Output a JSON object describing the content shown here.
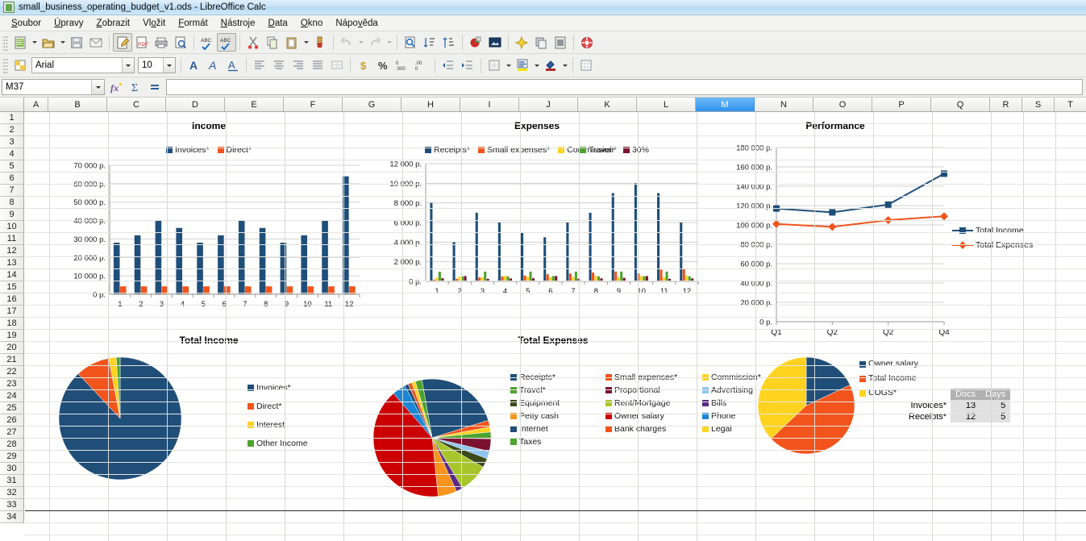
{
  "window": {
    "title": "small_business_operating_budget_v1.ods - LibreOffice Calc",
    "app_icon": "calc-document-icon"
  },
  "menubar": {
    "items": [
      {
        "label": "Soubor"
      },
      {
        "label": "Úpravy"
      },
      {
        "label": "Zobrazit"
      },
      {
        "label": "Vložit"
      },
      {
        "label": "Formát"
      },
      {
        "label": "Nástroje"
      },
      {
        "label": "Data"
      },
      {
        "label": "Okno"
      },
      {
        "label": "Nápověda"
      }
    ]
  },
  "formula_bar": {
    "name_box_value": "M37",
    "input_line_value": "",
    "function_wizard": "fx",
    "sum": "Σ",
    "formula": "="
  },
  "font_controls": {
    "font_name": "Arial",
    "font_size": "10"
  },
  "grid": {
    "columns": [
      "A",
      "B",
      "C",
      "D",
      "E",
      "F",
      "G",
      "H",
      "I",
      "J",
      "K",
      "L",
      "M",
      "N",
      "O",
      "P",
      "Q",
      "R",
      "S",
      "T"
    ],
    "selected_column": "M",
    "rows": [
      1,
      2,
      3,
      4,
      5,
      6,
      7,
      8,
      9,
      10,
      11,
      12,
      13,
      14,
      15,
      16,
      17,
      18,
      19,
      20,
      21,
      22,
      23,
      24,
      25,
      26,
      27,
      28,
      29,
      30,
      31,
      32,
      33,
      34
    ]
  },
  "colors": {
    "series_blue": "#1f4e79",
    "series_orange": "#f2541b",
    "series_yellow": "#ffd320",
    "series_green": "#4ca32e",
    "series_darkred": "#7b1230",
    "series_lightblue": "#8ec6f0",
    "series_darkgreen": "#3b4a1b",
    "series_olive": "#a8c62c",
    "series_purple": "#5b2a86",
    "series_lightorange": "#f7941e",
    "series_red": "#cc0000",
    "series_phone_blue": "#1887d6",
    "series_internet": "#1f4e79",
    "series_bank": "#f2541b",
    "series_legal": "#ffd320",
    "series_taxes": "#4ca32e",
    "selection_blue": "#2f92ef"
  },
  "chart_data": [
    {
      "type": "bar",
      "id": "income-bar-chart",
      "title": "Income",
      "xlabel": "",
      "ylabel": "",
      "ylim": [
        0,
        70000
      ],
      "ytick_labels": [
        "70 000 p.",
        "60 000 p.",
        "50 000 p.",
        "40 000 p.",
        "30 000 p.",
        "20 000 p.",
        "10 000 p.",
        "0 p."
      ],
      "ytick_values": [
        70000,
        60000,
        50000,
        40000,
        30000,
        20000,
        10000,
        0
      ],
      "categories": [
        "1",
        "2",
        "3",
        "4",
        "5",
        "6",
        "7",
        "8",
        "9",
        "10",
        "11",
        "12"
      ],
      "legend_position": "top",
      "grid": true,
      "series": [
        {
          "name": "Invoices*",
          "color": "#1f4e79",
          "values": [
            28000,
            32000,
            40000,
            36000,
            28000,
            32000,
            40000,
            36000,
            28000,
            32000,
            40000,
            64000
          ]
        },
        {
          "name": "Direct*",
          "color": "#f2541b",
          "values": [
            4300,
            4300,
            4300,
            4300,
            4300,
            4300,
            4300,
            4300,
            4300,
            4300,
            4300,
            4300
          ]
        }
      ]
    },
    {
      "type": "bar",
      "id": "expenses-bar-chart",
      "title": "Expenses",
      "xlabel": "",
      "ylabel": "",
      "ylim": [
        0,
        12000
      ],
      "ytick_labels": [
        "12 000 p.",
        "10 000 p.",
        "8 000 p.",
        "6 000 p.",
        "4 000 p.",
        "2 000 p.",
        "0 p."
      ],
      "ytick_values": [
        12000,
        10000,
        8000,
        6000,
        4000,
        2000,
        0
      ],
      "categories": [
        "1",
        "2",
        "3",
        "4",
        "5",
        "6",
        "7",
        "8",
        "9",
        "10",
        "11",
        "12"
      ],
      "legend_position": "top",
      "grid": true,
      "series": [
        {
          "name": "Receipts*",
          "color": "#1f4e79",
          "values": [
            8000,
            4000,
            7000,
            6000,
            5000,
            4500,
            6000,
            7000,
            9000,
            10000,
            9000,
            6000
          ]
        },
        {
          "name": "Small expenses*",
          "color": "#f2541b",
          "values": [
            180,
            260,
            400,
            500,
            600,
            730,
            800,
            900,
            1000,
            820,
            1200,
            1300
          ]
        },
        {
          "name": "Commission*",
          "color": "#ffd320",
          "values": [
            380,
            500,
            420,
            580,
            470,
            420,
            450,
            560,
            420,
            560,
            430,
            600
          ]
        },
        {
          "name": "Travel*",
          "color": "#4ca32e",
          "values": [
            980,
            520,
            990,
            520,
            1000,
            540,
            1000,
            520,
            1000,
            520,
            1000,
            520
          ]
        },
        {
          "name": "30%",
          "color": "#7b1230",
          "values": [
            320,
            540,
            260,
            300,
            320,
            540,
            270,
            310,
            360,
            540,
            260,
            300
          ]
        }
      ]
    },
    {
      "type": "line",
      "id": "performance-line-chart",
      "title": "Performance",
      "xlabel": "",
      "ylabel": "",
      "ylim": [
        0,
        180000
      ],
      "ytick_labels": [
        "180 000 p.",
        "160 000 p.",
        "140 000 p.",
        "120 000 p.",
        "100 000 p.",
        "80 000 p.",
        "60 000 p.",
        "40 000 p.",
        "20 000 p.",
        "0 p."
      ],
      "ytick_values": [
        180000,
        160000,
        140000,
        120000,
        100000,
        80000,
        60000,
        40000,
        20000,
        0
      ],
      "categories": [
        "Q1",
        "Q2",
        "Q2",
        "Q4"
      ],
      "legend_position": "right",
      "grid": true,
      "series": [
        {
          "name": "Total Income",
          "color": "#1f4e79",
          "marker": "square",
          "values": [
            117000,
            113000,
            121000,
            153000
          ]
        },
        {
          "name": "Total Expenses",
          "color": "#f2541b",
          "marker": "diamond",
          "values": [
            101000,
            98000,
            105000,
            109000
          ]
        }
      ]
    },
    {
      "type": "pie",
      "id": "total-income-pie-chart",
      "title": "Total Income",
      "legend_position": "right",
      "labels": [
        "Invoices*",
        "Direct*",
        "Interest",
        "Other Income"
      ],
      "values": [
        88,
        9,
        2,
        1
      ],
      "colors": [
        "#1f4e79",
        "#f2541b",
        "#ffd320",
        "#4ca32e"
      ]
    },
    {
      "type": "pie",
      "id": "total-expenses-pie-chart",
      "title": "Total Expenses",
      "legend_position": "right",
      "labels": [
        "Receipts*",
        "Small expenses*",
        "Commission*",
        "Travel*",
        "Proportional",
        "Advertising",
        "Equipment",
        "Rent/Mortgage",
        "Bills",
        "Petty cash",
        "Owner salary",
        "Phone",
        "Internet",
        "Bank charges",
        "Legal",
        "Taxes"
      ],
      "values": [
        20.0,
        1.6,
        1.2,
        1.6,
        3.0,
        1.8,
        2.2,
        7.0,
        1.6,
        4.5,
        35.0,
        3.2,
        0.9,
        0.9,
        0.9,
        1.6
      ],
      "colors": [
        "#1f4e79",
        "#f2541b",
        "#ffd320",
        "#4ca32e",
        "#7b1230",
        "#8ec6f0",
        "#3b4a1b",
        "#a8c62c",
        "#5b2a86",
        "#f7941e",
        "#cc0000",
        "#1887d6",
        "#1f4e79",
        "#f2541b",
        "#ffd320",
        "#4ca32e"
      ]
    },
    {
      "type": "pie",
      "id": "owner-salary-pie-chart",
      "title": "",
      "legend_position": "right",
      "labels": [
        "Owner salary",
        "Total Income",
        "COGS*"
      ],
      "values": [
        18,
        45,
        37
      ],
      "colors": [
        "#1f4e79",
        "#f2541b",
        "#ffd320"
      ]
    }
  ],
  "mini_table": {
    "headers": [
      "",
      "Docs",
      "Days"
    ],
    "rows": [
      {
        "label": "Invoices*",
        "docs": "13",
        "days": "5"
      },
      {
        "label": "Receipts*",
        "docs": "12",
        "days": "5"
      }
    ]
  }
}
